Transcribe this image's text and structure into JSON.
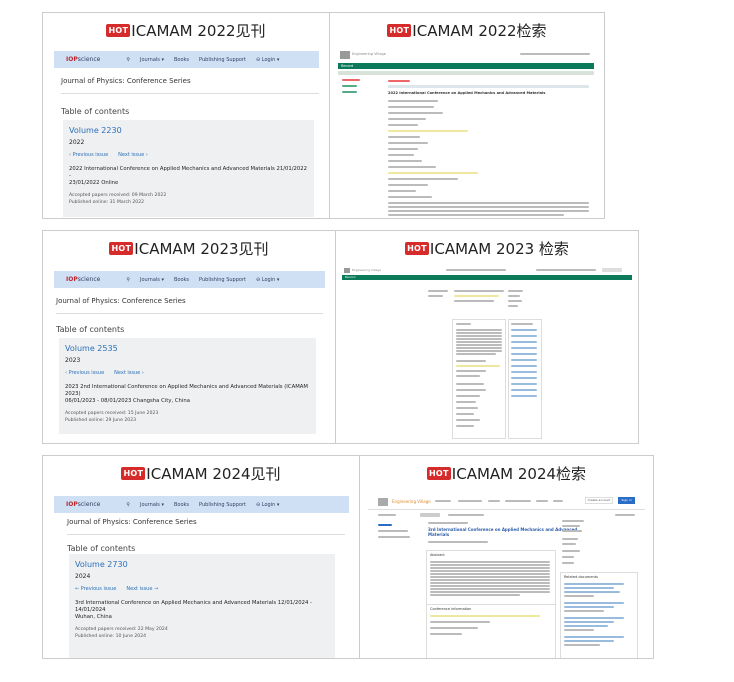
{
  "cells": [
    {
      "label": "ICAMAM 2022见刊"
    },
    {
      "label": "ICAMAM 2022检索"
    },
    {
      "label": "ICAMAM 2023见刊"
    },
    {
      "label": "ICAMAM 2023 检索"
    },
    {
      "label": "ICAMAM 2024见刊"
    },
    {
      "label": "ICAMAM 2024检索"
    }
  ],
  "hot_badge": "HOT",
  "iop": {
    "logo_iop": "IOP",
    "logo_science": "science",
    "nav": [
      "Journals ▾",
      "Books",
      "Publishing Support",
      "⊖ Login ▾"
    ],
    "journal_title": "Journal of Physics: Conference Series",
    "toc_label": "Table of contents",
    "volumes": [
      {
        "volume": "Volume 2230",
        "year": "2022",
        "prev": "‹ Previous issue",
        "next": "Next issue ›",
        "conference_line1": "2022 International Conference on Applied Mechanics and Advanced Materials 21/01/2022 -",
        "conference_line2": "23/01/2022 Online",
        "accepted": "Accepted papers received: 09 March 2022",
        "published": "Published online: 31 March 2022"
      },
      {
        "volume": "Volume 2535",
        "year": "2023",
        "prev": "‹ Previous issue",
        "next": "Next issue ›",
        "conference_line1": "2023 2nd International Conference on Applied Mechanics and Advanced Materials (ICAMAM 2023)",
        "conference_line2": "06/01/2023 - 08/01/2023 Changsha City, China",
        "accepted": "Accepted papers received: 15 June 2023",
        "published": "Published online: 29 June 2023"
      },
      {
        "volume": "Volume 2730",
        "year": "2024",
        "prev": "← Previous issue",
        "next": "Next issue →",
        "conference_line1": "3rd International Conference on Applied Mechanics and Advanced Materials 12/01/2024 - 14/01/2024",
        "conference_line2": "Wuhan, China",
        "accepted": "Accepted papers received: 22 May 2024",
        "published": "Published online: 10 June 2024"
      }
    ]
  },
  "ev": {
    "brand": "Engineering Village",
    "record_label": "Record",
    "record_title_2022": "2022 International Conference on Applied Mechanics and Advanced Materials",
    "record_title_2024_a": "3rd International Conference on Applied Mechanics and Advanced",
    "record_title_2024_b": "Materials",
    "abstract_label": "Abstract",
    "conf_info_label": "Conference information",
    "related_label": "Related documents",
    "create_alert": "Create account",
    "signin": "Sign in"
  }
}
